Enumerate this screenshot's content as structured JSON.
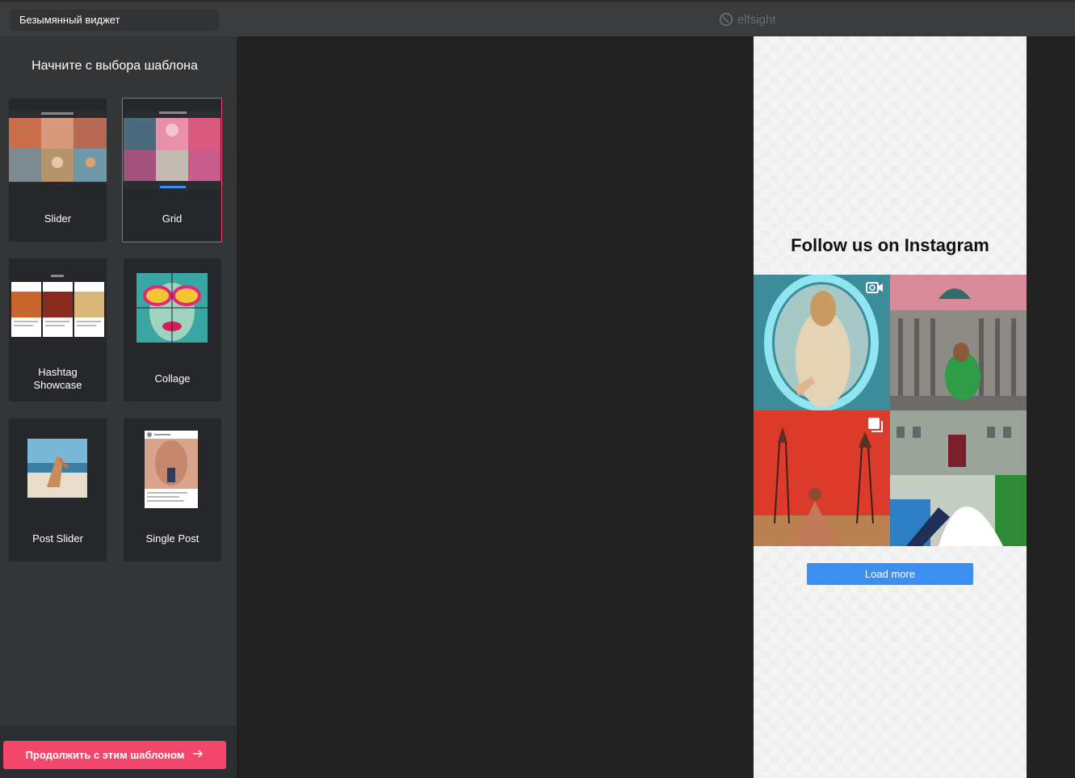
{
  "header": {
    "widget_name": "Безымянный виджет",
    "brand": "elfsight",
    "brand_icon": "elfsight-logo-icon"
  },
  "sidebar": {
    "title": "Начните с выбора шаблона",
    "templates": [
      {
        "label": "Slider",
        "selected": false
      },
      {
        "label": "Grid",
        "selected": true
      },
      {
        "label": "Hashtag Showcase",
        "selected": false
      },
      {
        "label": "Collage",
        "selected": false
      },
      {
        "label": "Post Slider",
        "selected": false
      },
      {
        "label": "Single Post",
        "selected": false
      }
    ],
    "continue_button": {
      "label": "Продолжить с этим шаблоном",
      "icon": "arrow-right-icon"
    }
  },
  "preview": {
    "title": "Follow us on Instagram",
    "load_more": "Load more",
    "tile_icons": [
      "video-icon",
      "",
      "gallery-icon",
      ""
    ]
  },
  "colors": {
    "accent": "#f2466b",
    "load_more": "#3a8ff0",
    "topbar": "#3a3b3d",
    "sidebar": "#343537"
  }
}
